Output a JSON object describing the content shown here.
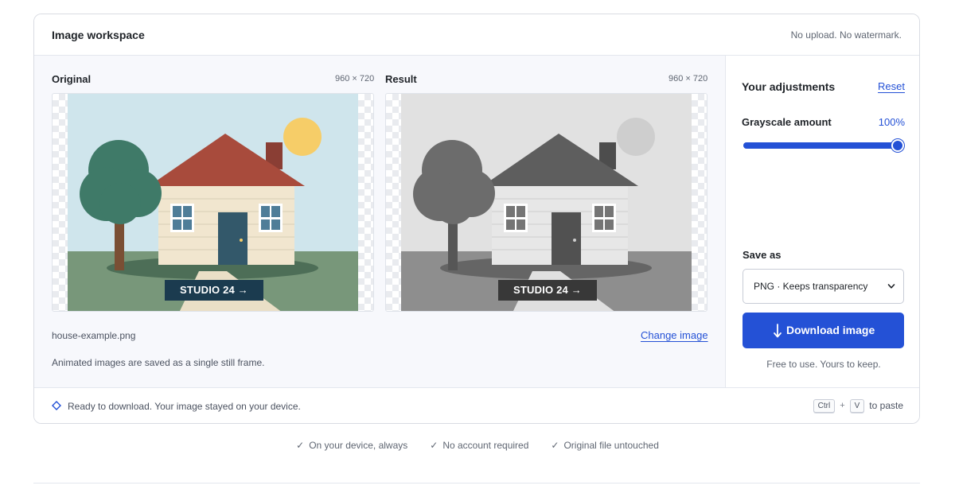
{
  "header": {
    "title": "Image workspace",
    "tagline": "No upload. No watermark."
  },
  "original": {
    "label": "Original",
    "dimensions": "960 × 720",
    "stamp_text": "STUDIO 24 →"
  },
  "result": {
    "label": "Result",
    "dimensions": "960 × 720",
    "stamp_text": "STUDIO 24 →"
  },
  "file": {
    "name": "house-example.png",
    "change_label": "Change image",
    "animated_note": "Animated images are saved as a single still frame."
  },
  "adjustments": {
    "title": "Your adjustments",
    "reset_label": "Reset",
    "slider_label": "Grayscale amount",
    "slider_value_text": "100%",
    "slider_value": 1.0
  },
  "save": {
    "label": "Save as",
    "format_selected": "PNG · Keeps transparency",
    "download_label": "Download image",
    "download_icon": "arrow-down-icon",
    "note": "Free to use. Yours to keep."
  },
  "status": {
    "icon": "diamond-icon",
    "text": "Ready to download. Your image stayed on your device.",
    "key1": "Ctrl",
    "plus": "+",
    "key2": "V",
    "paste_suffix": "to paste"
  },
  "trust": [
    "On your device, always",
    "No account required",
    "Original file untouched"
  ],
  "colors": {
    "accent": "#2451d6",
    "sky": "#cfe5ec",
    "roof": "#a84b3c",
    "wall": "#f1e6cf",
    "door": "#33586a",
    "grass": "#78977a",
    "tree": "#3f7a68",
    "trunk": "#7a4f34",
    "sun": "#f6cd68",
    "chimney": "#8a3e34",
    "window": "#4f7d98",
    "path": "#eadfc6",
    "shadow": "#4d6e57"
  }
}
